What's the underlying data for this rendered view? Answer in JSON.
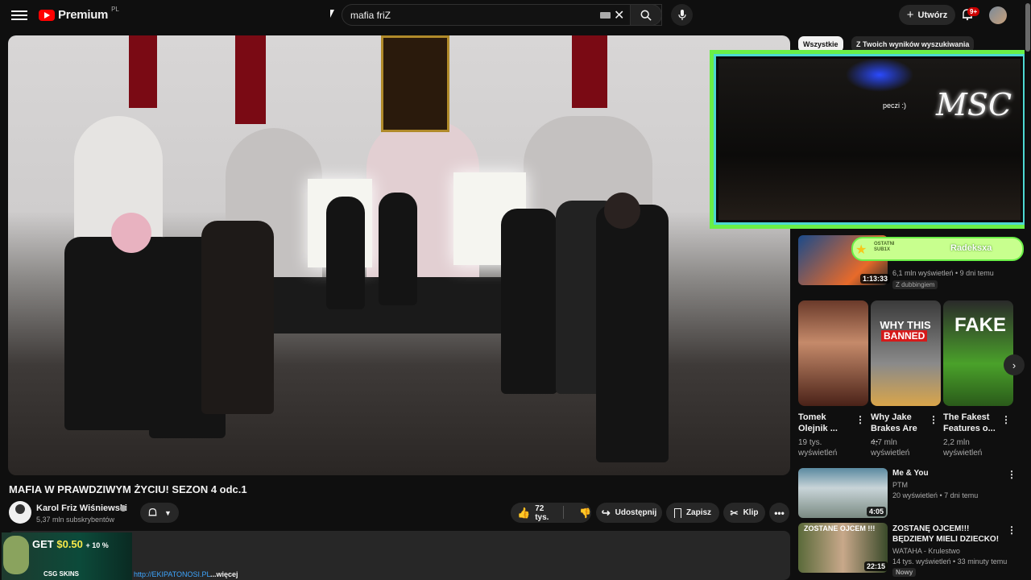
{
  "header": {
    "logo_text": "Premium",
    "logo_region": "PL",
    "search_value": "mafia friZ",
    "create_label": "Utwórz",
    "notifications_badge": "9+"
  },
  "video": {
    "title": "MAFIA W PRAWDZIWYM ŻYCIU! SEZON 4 odc.1",
    "channel_name": "Karol Friz Wiśniewski",
    "subscribers": "5,37 mln subskrybentów",
    "likes": "72 tys.",
    "share_label": "Udostępnij",
    "save_label": "Zapisz",
    "clip_label": "Klip",
    "description_link": "http://EKIPATONOSI.PL",
    "description_more": "...więcej"
  },
  "ad": {
    "text_prefix": "GET",
    "amount": "$0.50",
    "plus": "+ 10 %",
    "brand": "CSG SKINS"
  },
  "chips": {
    "all": "Wszystkie",
    "yours": "Z Twoich wyników wyszukiwania"
  },
  "overlay": {
    "cam_text": "MSC",
    "cam_note": "peczi :)",
    "sub_label_1": "OSTATNI",
    "sub_label_2": "SUB1X",
    "sub_name": "Radeksxa"
  },
  "rec1": {
    "duration": "1:13:33",
    "views": "6,1 mln wyświetleń • 9 dni temu",
    "badge": "Z dubbingiem"
  },
  "shorts": [
    {
      "title": "Tomek Olejnik ...",
      "views_1": "19 tys.",
      "views_2": "wyświetleń"
    },
    {
      "title": "Why Jake Brakes Are ...",
      "views_1": "4,7 mln",
      "views_2": "wyświetleń",
      "overlay_1": "WHY THIS",
      "overlay_2": "BANNED"
    },
    {
      "title": "The Fakest Features o...",
      "views_1": "2,2 mln",
      "views_2": "wyświetleń",
      "overlay_1": "FAKE"
    }
  ],
  "rec2": {
    "title": "Me & You",
    "channel": "PTM",
    "meta": "20 wyświetleń • 7 dni temu",
    "duration": "4:05"
  },
  "rec3": {
    "title": "ZOSTANĘ OJCEM!!! BĘDZIEMY MIELI DZIECKO!",
    "channel": "WATAHA - Krulestwo",
    "meta": "14 tys. wyświetleń • 33 minuty temu",
    "badge": "Nowy",
    "duration": "22:15",
    "overlay": "ZOSTANE OJCEM !!!"
  },
  "colors": {
    "bg": "#0f0f0f",
    "accent_red": "#ff0000",
    "overlay_green": "#6aef47",
    "link_blue": "#3ea6ff"
  }
}
